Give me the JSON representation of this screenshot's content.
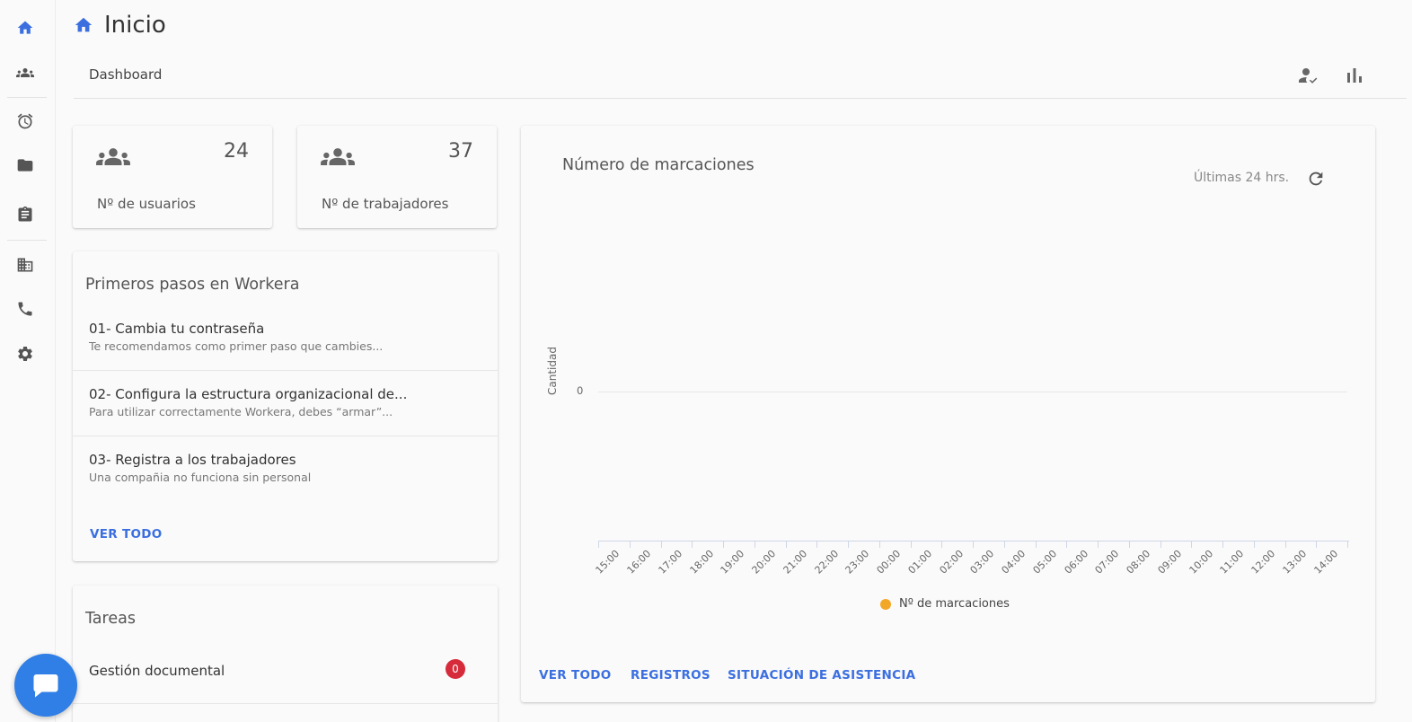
{
  "header": {
    "title": "Inicio",
    "breadcrumb": "Dashboard"
  },
  "sidebar": {
    "icons": [
      "home-icon",
      "people-icon",
      "alarm-icon",
      "folder-icon",
      "clipboard-icon",
      "building-icon",
      "phone-icon",
      "gear-icon"
    ]
  },
  "stats": [
    {
      "label": "Nº de usuarios",
      "value": "24"
    },
    {
      "label": "Nº de trabajadores",
      "value": "37"
    }
  ],
  "steps": {
    "title": "Primeros pasos en Workera",
    "items": [
      {
        "title": "01- Cambia tu contraseña",
        "desc": "Te recomendamos como primer paso que cambies..."
      },
      {
        "title": "02- Configura la estructura organizacional de...",
        "desc": "Para utilizar correctamente Workera, debes “armar”..."
      },
      {
        "title": "03- Registra a los trabajadores",
        "desc": "Una compañia no funciona sin personal"
      }
    ],
    "link": "VER TODO"
  },
  "tasks": {
    "title": "Tareas",
    "items": [
      {
        "label": "Gestión documental",
        "count": "0"
      }
    ]
  },
  "chart_data": {
    "type": "line",
    "title": "Número de marcaciones",
    "period": "Últimas 24 hrs.",
    "ylabel": "Cantidad",
    "yticks": [
      "0"
    ],
    "categories": [
      "15:00",
      "16:00",
      "17:00",
      "18:00",
      "19:00",
      "20:00",
      "21:00",
      "22:00",
      "23:00",
      "00:00",
      "01:00",
      "02:00",
      "03:00",
      "04:00",
      "05:00",
      "06:00",
      "07:00",
      "08:00",
      "09:00",
      "10:00",
      "11:00",
      "12:00",
      "13:00",
      "14:00"
    ],
    "series": [
      {
        "name": "Nº de marcaciones",
        "color": "#f3a726",
        "values": []
      }
    ],
    "legend": "bottom"
  },
  "chart_links": [
    "VER TODO",
    "REGISTROS",
    "SITUACIÓN DE ASISTENCIA"
  ],
  "colors": {
    "accent": "#3b6fe0",
    "badge": "#d62b3a",
    "series": "#f3a726"
  }
}
